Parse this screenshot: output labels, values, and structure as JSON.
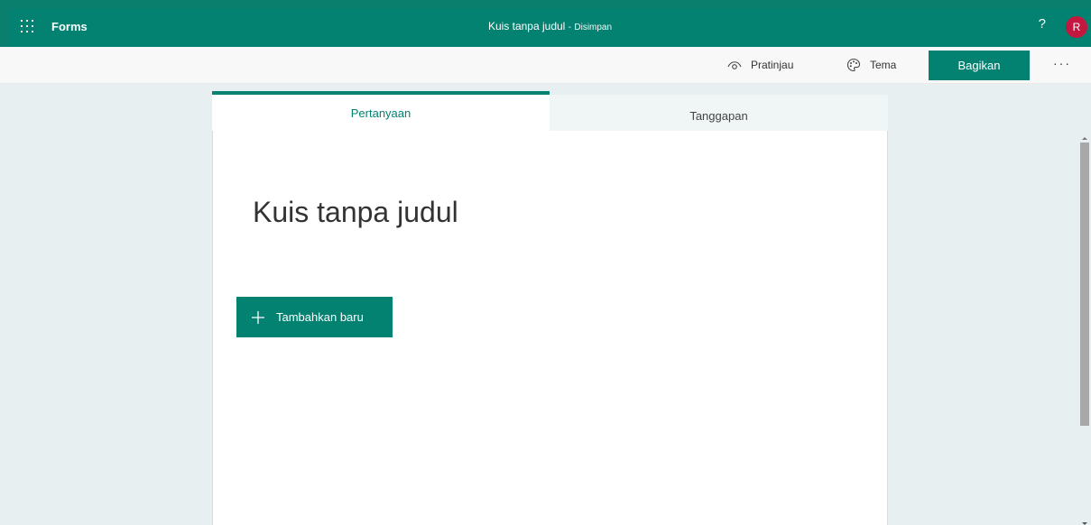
{
  "header": {
    "app_name": "Forms",
    "doc_title": "Kuis tanpa judul",
    "separator": "-",
    "save_status": "Disimpan",
    "help_label": "?",
    "avatar_initial": "R"
  },
  "toolbar": {
    "preview_label": "Pratinjau",
    "theme_label": "Tema",
    "share_label": "Bagikan",
    "more_label": "···"
  },
  "tabs": [
    {
      "label": "Pertanyaan",
      "active": true
    },
    {
      "label": "Tanggapan",
      "active": false
    }
  ],
  "form": {
    "title": "Kuis tanpa judul",
    "add_new_label": "Tambahkan baru"
  },
  "colors": {
    "accent": "#038272",
    "avatar": "#c4173f",
    "background": "#e8eff1"
  },
  "icons": {
    "waffle": "waffle-icon",
    "preview": "eye-icon",
    "theme": "palette-icon",
    "add": "plus-icon",
    "help": "help-icon"
  }
}
